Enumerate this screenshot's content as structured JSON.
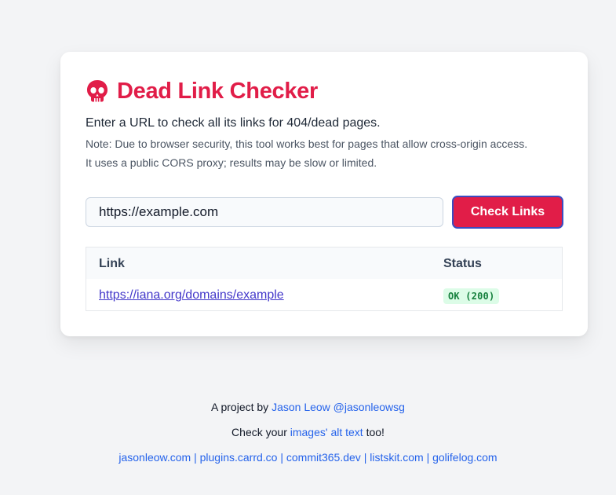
{
  "header": {
    "icon": "skull-icon",
    "title": "Dead Link Checker"
  },
  "intro": "Enter a URL to check all its links for 404/dead pages.",
  "notes": [
    "Note: Due to browser security, this tool works best for pages that allow cross-origin access.",
    "It uses a public CORS proxy; results may be slow or limited."
  ],
  "form": {
    "url_value": "https://example.com",
    "button_label": "Check Links"
  },
  "results": {
    "columns": [
      "Link",
      "Status"
    ],
    "rows": [
      {
        "link": "https://iana.org/domains/example",
        "status": "OK (200)"
      }
    ]
  },
  "footer": {
    "line1_prefix": "A project by ",
    "line1_link": "Jason Leow @jasonleowsg",
    "line2_prefix": "Check your ",
    "line2_link": "images' alt text",
    "line2_suffix": " too!",
    "links": [
      "jasonleow.com",
      "plugins.carrd.co",
      "commit365.dev",
      "listskit.com",
      "golifelog.com"
    ],
    "separator": " | "
  },
  "colors": {
    "accent": "#e11d48",
    "link": "#2563eb",
    "status_ok_bg": "#dcfce7",
    "status_ok_text": "#15803d"
  }
}
